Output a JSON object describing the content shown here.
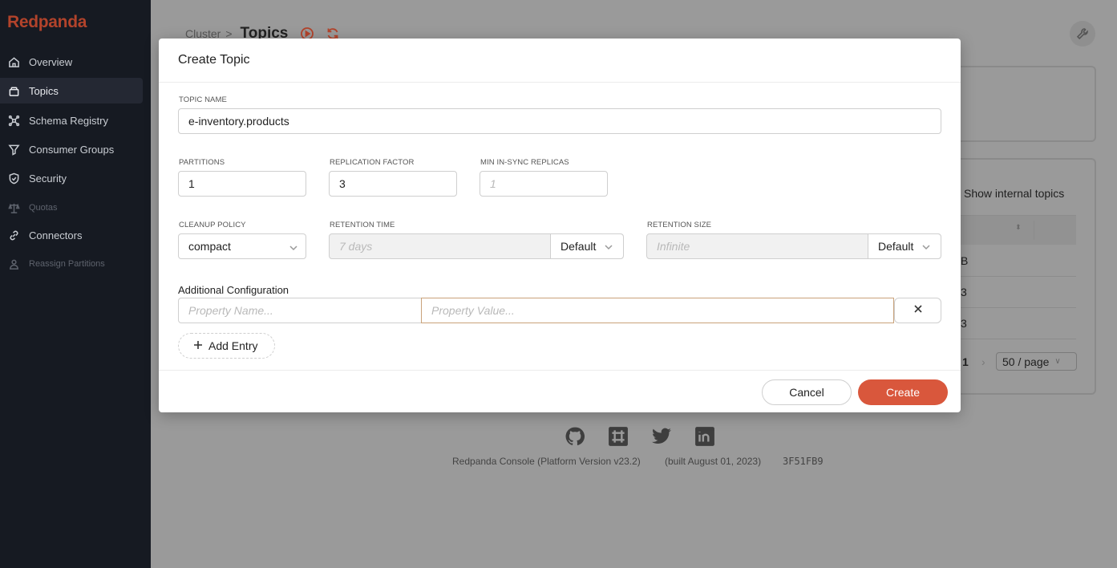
{
  "app": {
    "logo": "Redpanda"
  },
  "sidebar": {
    "items": [
      {
        "label": "Overview",
        "icon": "home-icon",
        "state": "normal"
      },
      {
        "label": "Topics",
        "icon": "topics-icon",
        "state": "active"
      },
      {
        "label": "Schema Registry",
        "icon": "schema-icon",
        "state": "normal"
      },
      {
        "label": "Consumer Groups",
        "icon": "filter-icon",
        "state": "normal"
      },
      {
        "label": "Security",
        "icon": "shield-icon",
        "state": "normal"
      },
      {
        "label": "Quotas",
        "icon": "scale-icon",
        "state": "disabled"
      },
      {
        "label": "Connectors",
        "icon": "link-icon",
        "state": "normal"
      },
      {
        "label": "Reassign Partitions",
        "icon": "user-icon",
        "state": "disabled"
      }
    ]
  },
  "breadcrumb": {
    "parent": "Cluster",
    "separator": ">",
    "current": "Topics"
  },
  "background": {
    "show_internal_topics": "Show internal topics",
    "row_fragments": [
      "B",
      "3",
      "3"
    ],
    "pager_page": "1",
    "pager_size": "50 / page"
  },
  "footer": {
    "version": "Redpanda Console (Platform Version v23.2)",
    "built": "(built August 01, 2023)",
    "hash": "3F51FB9"
  },
  "modal": {
    "title": "Create Topic",
    "topic_name_label": "TOPIC NAME",
    "topic_name_value": "e-inventory.products",
    "partitions_label": "PARTITIONS",
    "partitions_value": "1",
    "replication_label": "REPLICATION FACTOR",
    "replication_value": "3",
    "min_isr_label": "MIN IN-SYNC REPLICAS",
    "min_isr_placeholder": "1",
    "cleanup_label": "CLEANUP POLICY",
    "cleanup_value": "compact",
    "retention_time_label": "RETENTION TIME",
    "retention_time_placeholder": "7 days",
    "retention_time_unit": "Default",
    "retention_size_label": "RETENTION SIZE",
    "retention_size_placeholder": "Infinite",
    "retention_size_unit": "Default",
    "additional_config_label": "Additional Configuration",
    "property_name_placeholder": "Property Name...",
    "property_value_placeholder": "Property Value...",
    "add_entry": "Add Entry",
    "cancel": "Cancel",
    "create": "Create"
  },
  "colors": {
    "accent": "#d9573c",
    "brand": "#b2432b",
    "sidebar_bg": "#161a22"
  }
}
